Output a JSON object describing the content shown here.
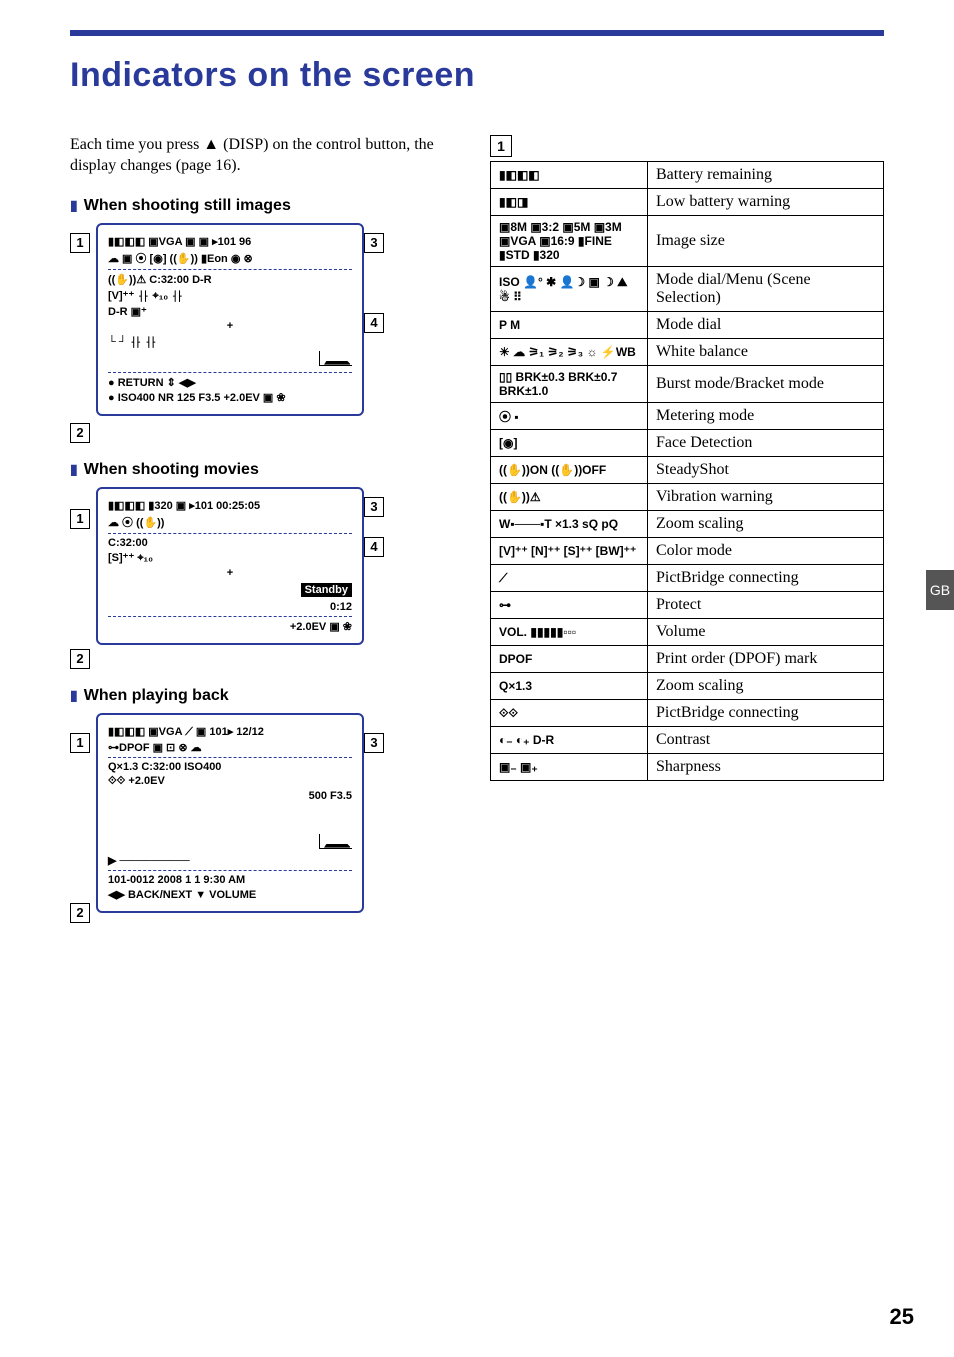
{
  "page": {
    "title": "Indicators on the screen",
    "intro_before_tri": "Each time you press ",
    "intro_tri": "▲",
    "intro_after_tri": " (DISP) on the control button, the display changes (page 16).",
    "number": "25",
    "side_tab": "GB"
  },
  "sections": {
    "still": "When shooting still images",
    "movies": "When shooting movies",
    "playback": "When playing back"
  },
  "diagrams": {
    "still": {
      "row1": "▮◧◧◧   ▣VGA ▣   ▣ ▸101        96",
      "row2": "☁ ▣ ⦿ [◉]   ((✋))           ▮Eon ◉ ⊗",
      "row3": "                ((✋))⚠   C:32:00   D‑R",
      "row4": "[V]⁺⁺         ⸡⸠     ⌖₁₀     ⸡⸠",
      "row5": "D‑R  ▣⁺",
      "row6": "                       +",
      "row7": "          └ ┘   ⸡⸠          ⸡⸠",
      "row8": "● RETURN       ⇕   ◀▶",
      "row9": "● ISO400  NR  125  F3.5 +2.0EV  ▣ ❀"
    },
    "movies": {
      "row1": "▮◧◧◧     ▮320    ▣ ▸101   00:25:05",
      "row2": "☁    ⦿        ((✋))",
      "row3": "                          C:32:00",
      "row4": "[S]⁺⁺           ⌖₁₀",
      "row5": "                  +",
      "row6": "                              Standby",
      "row7": "                                0:12",
      "row8": "                     +2.0EV  ▣ ❀"
    },
    "playback": {
      "row1": "▮◧◧◧   ▣VGA ⟋   ▣  101▸   12/12",
      "row2": "   ⊶DPOF     ▣        ⊡ ⊗ ☁",
      "row3": "Q×1.3           C:32:00  ISO400",
      "row4": "            ⟐⟐           +2.0EV",
      "row5": "                        500 F3.5",
      "row6": "▶ ─────────",
      "row7": "101‑0012   2008   1 1   9:30  AM",
      "row8": "◀▶ BACK/NEXT   ▼ VOLUME"
    }
  },
  "callouts": {
    "c1": "1",
    "c2": "2",
    "c3": "3",
    "c4": "4"
  },
  "table": {
    "header_num": "1",
    "rows": [
      {
        "icon": "▮◧◧◧",
        "desc": "Battery remaining"
      },
      {
        "icon": "▮◧◨",
        "desc": "Low battery warning"
      },
      {
        "icon": "▣8M ▣3:2 ▣5M ▣3M ▣VGA ▣16:9 ▮FINE ▮STD ▮320",
        "desc": "Image size"
      },
      {
        "icon": "ISO  👤°  ✱  👤☽  ▣  ☽  ⛰  ☃  ⠿",
        "desc": "Mode dial/Menu (Scene Selection)"
      },
      {
        "icon": "P  M",
        "desc": "Mode dial"
      },
      {
        "icon": "☀ ☁ ⚞₁ ⚞₂ ⚞₃ ☼ ⚡WB",
        "desc": "White balance"
      },
      {
        "icon": "▯▯  BRK±0.3  BRK±0.7  BRK±1.0",
        "desc": "Burst mode/Bracket mode"
      },
      {
        "icon": "⦿  ▪",
        "desc": "Metering mode"
      },
      {
        "icon": "[◉]",
        "desc": "Face Detection"
      },
      {
        "icon": "((✋))ON  ((✋))OFF",
        "desc": "SteadyShot"
      },
      {
        "icon": "((✋))⚠",
        "desc": "Vibration warning"
      },
      {
        "icon": "W▪───▪T   ×1.3  sQ  pQ",
        "desc": "Zoom scaling"
      },
      {
        "icon": "[V]⁺⁺  [N]⁺⁺  [S]⁺⁺  [BW]⁺⁺",
        "desc": "Color mode"
      },
      {
        "icon": "⟋",
        "desc": "PictBridge connecting"
      },
      {
        "icon": "⊶",
        "desc": "Protect"
      },
      {
        "icon": "VOL. ▮▮▮▮▮▫▫▫",
        "desc": "Volume"
      },
      {
        "icon": "DPOF",
        "desc": "Print order (DPOF) mark"
      },
      {
        "icon": "Q×1.3",
        "desc": "Zoom scaling"
      },
      {
        "icon": "⟐⟐",
        "desc": "PictBridge connecting"
      },
      {
        "icon": "◐₋ ◐₊ D‑R",
        "desc": "Contrast"
      },
      {
        "icon": "▣₋ ▣₊",
        "desc": "Sharpness"
      }
    ]
  }
}
